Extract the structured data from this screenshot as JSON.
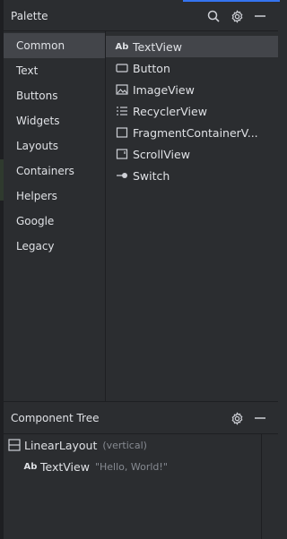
{
  "palette": {
    "title": "Palette",
    "categories": [
      "Common",
      "Text",
      "Buttons",
      "Widgets",
      "Layouts",
      "Containers",
      "Helpers",
      "Google",
      "Legacy"
    ],
    "widgets": [
      {
        "icon_text": "Ab",
        "icon": "textview-icon",
        "label": "TextView"
      },
      {
        "icon": "button-icon",
        "label": "Button"
      },
      {
        "icon": "image-icon",
        "label": "ImageView"
      },
      {
        "icon": "list-icon",
        "label": "RecyclerView"
      },
      {
        "icon": "fragment-icon",
        "label": "FragmentContainerV..."
      },
      {
        "icon": "scrollview-icon",
        "label": "ScrollView"
      },
      {
        "icon": "switch-icon",
        "label": "Switch"
      }
    ]
  },
  "component_tree": {
    "title": "Component Tree",
    "nodes": [
      {
        "name": "LinearLayout",
        "detail": "(vertical)",
        "icon": "linearlayout-icon"
      },
      {
        "icon_text": "Ab",
        "name": "TextView",
        "detail": "\"Hello, World!\"",
        "icon": "textview-icon"
      }
    ]
  },
  "colors": {
    "background": "#2b2d30",
    "selection": "#43454a",
    "accent": "#3574f0",
    "secondary_text": "#868a91"
  }
}
